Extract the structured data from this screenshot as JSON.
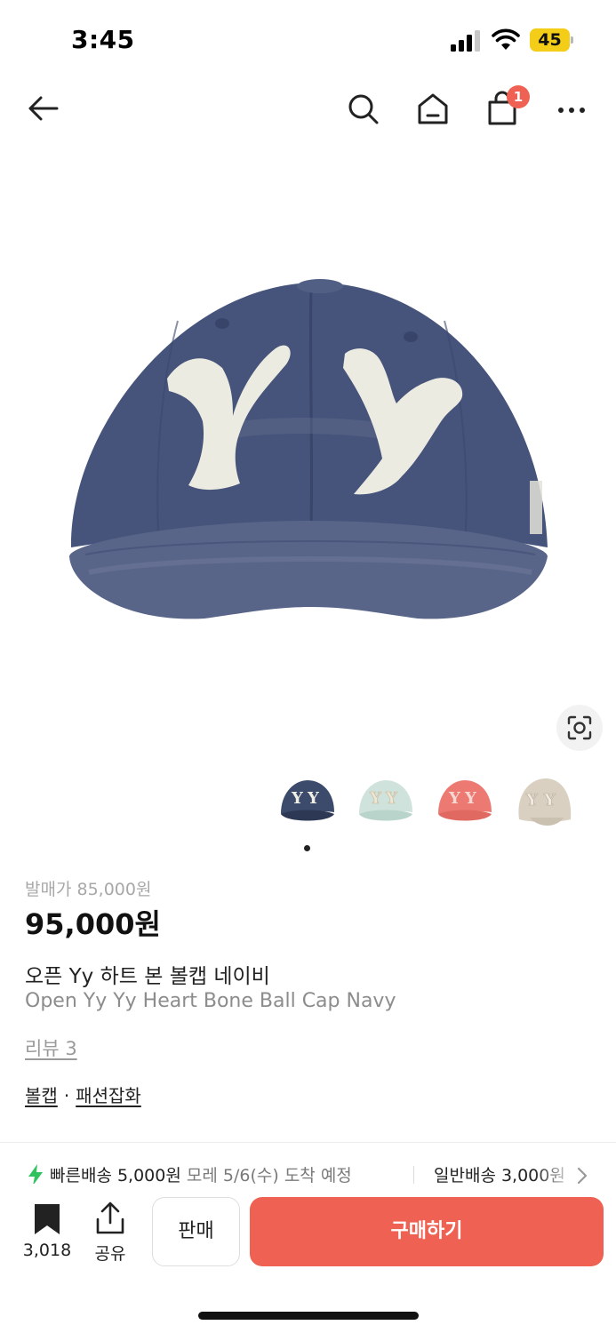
{
  "status_bar": {
    "time": "3:45",
    "battery": "45"
  },
  "nav": {
    "cart_count": "1"
  },
  "product": {
    "release_price_label": "발매가",
    "release_price": "85,000원",
    "price": "95,000원",
    "name_ko": "오픈 Yy 하트 본 볼캡 네이비",
    "name_en": "Open Yy Yy Heart Bone Ball Cap Navy",
    "review_link": "리뷰 3",
    "categories": [
      "볼캡",
      "패션잡화"
    ],
    "category_separator": "·",
    "thumbnail_colors": [
      "#3c4a6b",
      "#cfe3dc",
      "#ec7a72",
      "#d9d0c2"
    ]
  },
  "shipping": {
    "fast_label": "빠른배송 5,000원",
    "fast_date": "모레 5/6(수) 도착 예정",
    "normal_label": "일반배송 3,000원"
  },
  "bottom_bar": {
    "bookmark_count": "3,018",
    "share_label": "공유",
    "sell_label": "판매",
    "buy_label": "구매하기"
  },
  "colors": {
    "accent": "#ef6253",
    "fast_shipping": "#2fc35e",
    "battery": "#f3cd18"
  }
}
